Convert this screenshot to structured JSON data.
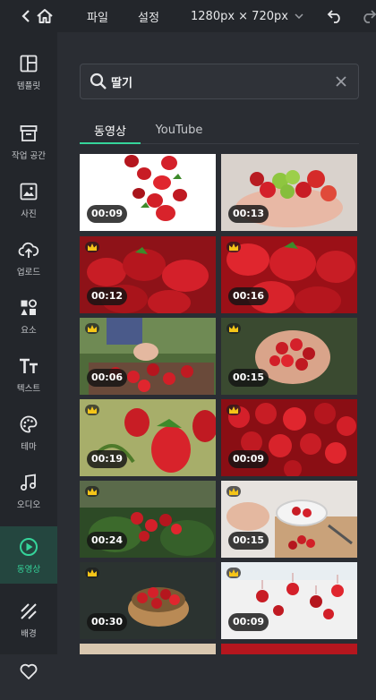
{
  "topbar": {
    "file_menu": "파일",
    "settings_menu": "설정",
    "canvas_size": "1280px × 720px"
  },
  "sidebar": {
    "items": [
      {
        "label": "템플릿",
        "icon": "template-icon"
      },
      {
        "label": "작업 공간",
        "icon": "workspace-icon"
      },
      {
        "label": "사진",
        "icon": "photo-icon"
      },
      {
        "label": "업로드",
        "icon": "upload-icon"
      },
      {
        "label": "요소",
        "icon": "elements-icon"
      },
      {
        "label": "텍스트",
        "icon": "text-icon"
      },
      {
        "label": "테마",
        "icon": "theme-icon"
      },
      {
        "label": "오디오",
        "icon": "audio-icon"
      },
      {
        "label": "동영상",
        "icon": "video-icon",
        "active": true
      },
      {
        "label": "배경",
        "icon": "background-icon"
      }
    ]
  },
  "search": {
    "value": "딸기"
  },
  "tabs": [
    {
      "label": "동영상",
      "active": true
    },
    {
      "label": "YouTube",
      "active": false
    }
  ],
  "videos": [
    {
      "duration": "00:09",
      "premium": false
    },
    {
      "duration": "00:13",
      "premium": false
    },
    {
      "duration": "00:12",
      "premium": true
    },
    {
      "duration": "00:16",
      "premium": true
    },
    {
      "duration": "00:06",
      "premium": true
    },
    {
      "duration": "00:15",
      "premium": true
    },
    {
      "duration": "00:19",
      "premium": true
    },
    {
      "duration": "00:09",
      "premium": true
    },
    {
      "duration": "00:24",
      "premium": true
    },
    {
      "duration": "00:15",
      "premium": true
    },
    {
      "duration": "00:30",
      "premium": true
    },
    {
      "duration": "00:09",
      "premium": true
    }
  ],
  "colors": {
    "accent": "#35d49a",
    "premium_crown": "#f5c518",
    "background": "#2a2d33",
    "panel": "#23262b"
  }
}
